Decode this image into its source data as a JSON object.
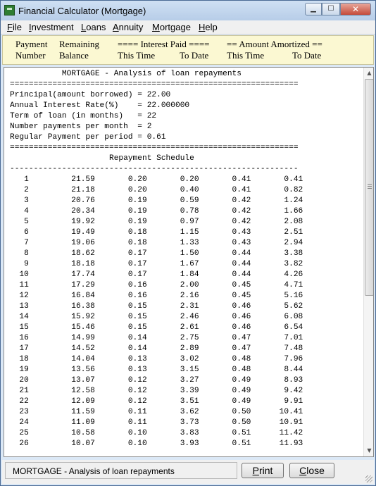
{
  "window": {
    "title": "Financial Calculator (Mortgage)",
    "minimize_glyph": "▁",
    "maximize_glyph": "☐",
    "close_glyph": "✕"
  },
  "menu": [
    {
      "hot": "F",
      "rest": "ile"
    },
    {
      "hot": "I",
      "rest": "nvestment"
    },
    {
      "hot": "L",
      "rest": "oans"
    },
    {
      "hot": "A",
      "rest": "nnuity"
    },
    {
      "hot": "M",
      "rest": "ortgage"
    },
    {
      "hot": "H",
      "rest": "elp"
    }
  ],
  "columns": {
    "payment": "Payment",
    "number": "Number",
    "remaining": "Remaining",
    "balance": "Balance",
    "interest_group": "==== Interest Paid ====",
    "interest_this_time": "This Time",
    "interest_to_date": "To Date",
    "amortized_group": "== Amount Amortized ==",
    "amortized_this_time": "This Time",
    "amortized_to_date": "To Date"
  },
  "report": {
    "title": "MORTGAGE - Analysis of loan repayments",
    "separator": "=============================================================",
    "dash_separator": "-------------------------------------------------------------",
    "summary": [
      {
        "label": "Principal(amount borrowed)",
        "value": "22.00"
      },
      {
        "label": "Annual Interest Rate(%)",
        "value": "22.000000"
      },
      {
        "label": "Term of loan (in months)",
        "value": "22"
      },
      {
        "label": "Number payments per month",
        "value": "2"
      },
      {
        "label": "Regular Payment per period",
        "value": "0.61"
      }
    ],
    "schedule_title": "Repayment Schedule",
    "rows": [
      [
        "1",
        "21.59",
        "0.20",
        "0.20",
        "0.41",
        "0.41"
      ],
      [
        "2",
        "21.18",
        "0.20",
        "0.40",
        "0.41",
        "0.82"
      ],
      [
        "3",
        "20.76",
        "0.19",
        "0.59",
        "0.42",
        "1.24"
      ],
      [
        "4",
        "20.34",
        "0.19",
        "0.78",
        "0.42",
        "1.66"
      ],
      [
        "5",
        "19.92",
        "0.19",
        "0.97",
        "0.42",
        "2.08"
      ],
      [
        "6",
        "19.49",
        "0.18",
        "1.15",
        "0.43",
        "2.51"
      ],
      [
        "7",
        "19.06",
        "0.18",
        "1.33",
        "0.43",
        "2.94"
      ],
      [
        "8",
        "18.62",
        "0.17",
        "1.50",
        "0.44",
        "3.38"
      ],
      [
        "9",
        "18.18",
        "0.17",
        "1.67",
        "0.44",
        "3.82"
      ],
      [
        "10",
        "17.74",
        "0.17",
        "1.84",
        "0.44",
        "4.26"
      ],
      [
        "11",
        "17.29",
        "0.16",
        "2.00",
        "0.45",
        "4.71"
      ],
      [
        "12",
        "16.84",
        "0.16",
        "2.16",
        "0.45",
        "5.16"
      ],
      [
        "13",
        "16.38",
        "0.15",
        "2.31",
        "0.46",
        "5.62"
      ],
      [
        "14",
        "15.92",
        "0.15",
        "2.46",
        "0.46",
        "6.08"
      ],
      [
        "15",
        "15.46",
        "0.15",
        "2.61",
        "0.46",
        "6.54"
      ],
      [
        "16",
        "14.99",
        "0.14",
        "2.75",
        "0.47",
        "7.01"
      ],
      [
        "17",
        "14.52",
        "0.14",
        "2.89",
        "0.47",
        "7.48"
      ],
      [
        "18",
        "14.04",
        "0.13",
        "3.02",
        "0.48",
        "7.96"
      ],
      [
        "19",
        "13.56",
        "0.13",
        "3.15",
        "0.48",
        "8.44"
      ],
      [
        "20",
        "13.07",
        "0.12",
        "3.27",
        "0.49",
        "8.93"
      ],
      [
        "21",
        "12.58",
        "0.12",
        "3.39",
        "0.49",
        "9.42"
      ],
      [
        "22",
        "12.09",
        "0.12",
        "3.51",
        "0.49",
        "9.91"
      ],
      [
        "23",
        "11.59",
        "0.11",
        "3.62",
        "0.50",
        "10.41"
      ],
      [
        "24",
        "11.09",
        "0.11",
        "3.73",
        "0.50",
        "10.91"
      ],
      [
        "25",
        "10.58",
        "0.10",
        "3.83",
        "0.51",
        "11.42"
      ],
      [
        "26",
        "10.07",
        "0.10",
        "3.93",
        "0.51",
        "11.93"
      ]
    ]
  },
  "scrollbar": {
    "up_glyph": "▲",
    "down_glyph": "▼"
  },
  "status": {
    "text": "MORTGAGE - Analysis of loan repayments",
    "print_hot": "P",
    "print_rest": "rint",
    "close_hot": "C",
    "close_rest": "lose"
  }
}
